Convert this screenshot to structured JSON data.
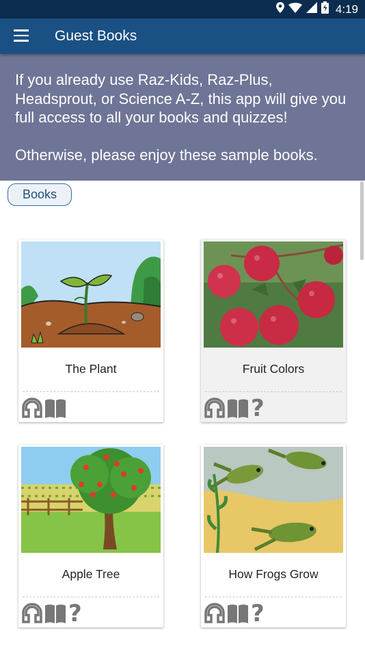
{
  "status_bar": {
    "time": "4:19"
  },
  "app_bar": {
    "title": "Guest Books"
  },
  "banner": {
    "paragraph1": "If you already use Raz-Kids, Raz-Plus, Headsprout, or Science A-Z, this app will give you full access to all your books and quizzes!",
    "paragraph2": "Otherwise, please enjoy these sample books."
  },
  "filter": {
    "books_label": "Books"
  },
  "books": [
    {
      "title": "The Plant",
      "icons": [
        "headphones-icon",
        "book-icon"
      ]
    },
    {
      "title": "Fruit Colors",
      "icons": [
        "headphones-icon",
        "book-icon",
        "quiz-icon"
      ]
    },
    {
      "title": "Apple Tree",
      "icons": [
        "headphones-icon",
        "book-icon",
        "quiz-icon"
      ]
    },
    {
      "title": "How Frogs Grow",
      "icons": [
        "headphones-icon",
        "book-icon",
        "quiz-icon"
      ]
    }
  ],
  "colors": {
    "status_bar": "#0d2d50",
    "app_bar": "#1a5083",
    "banner": "#6f7596",
    "chip_border": "#2f6fa8",
    "icon_gray": "#777777"
  }
}
